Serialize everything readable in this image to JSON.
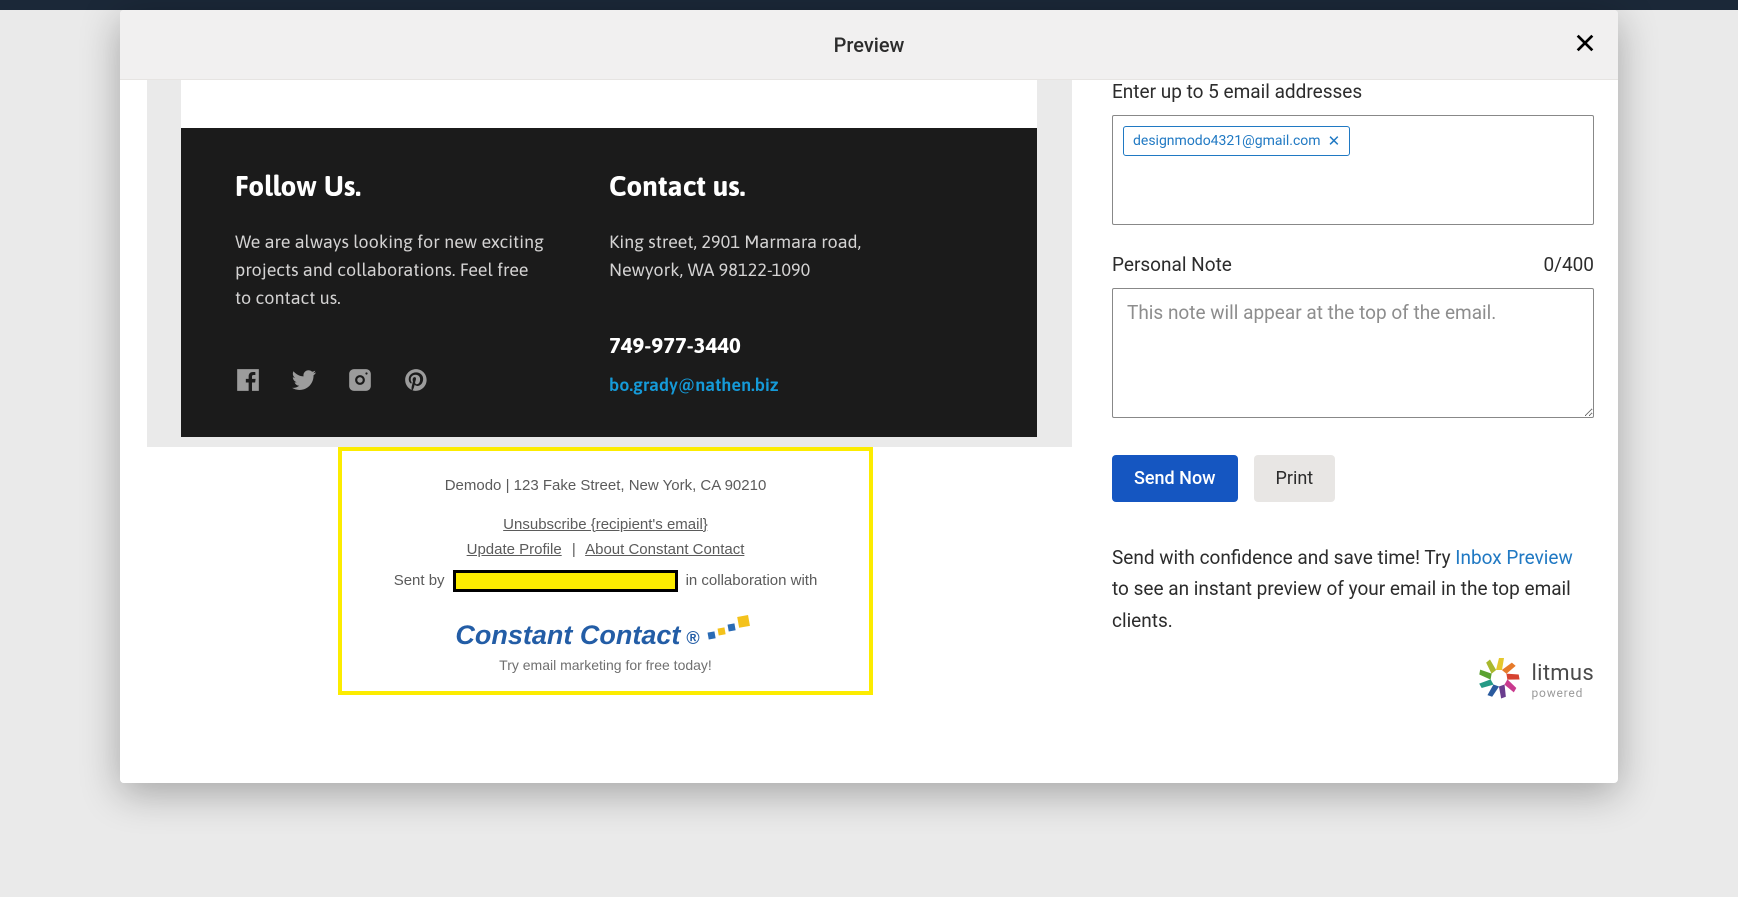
{
  "modal": {
    "title": "Preview"
  },
  "email_footer": {
    "follow": {
      "heading": "Follow Us.",
      "text": "We are always looking for new exciting projects and collaborations. Feel free to contact us."
    },
    "contact": {
      "heading": "Contact us.",
      "address": "King street, 2901 Marmara road, Newyork, WA 98122-1090",
      "phone": "749-977-3440",
      "email": "bo.grady@nathen.biz"
    }
  },
  "cc_footer": {
    "address": "Demodo | 123 Fake Street, New York, CA 90210",
    "unsubscribe": "Unsubscribe {recipient's email}",
    "update_profile": "Update Profile",
    "about": "About Constant Contact",
    "sent_by_prefix": "Sent by",
    "collab": "in collaboration with",
    "logo_text": "Constant Contact",
    "try_text": "Try email marketing for free today!"
  },
  "form": {
    "email_label": "Enter up to 5 email addresses",
    "chips": [
      "designmodo4321@gmail.com"
    ],
    "note_label": "Personal Note",
    "note_count": "0/400",
    "note_placeholder": "This note will appear at the top of the email.",
    "send_btn": "Send Now",
    "print_btn": "Print"
  },
  "promo": {
    "text_1": "Send with confidence and save time! Try ",
    "link": "Inbox Preview",
    "text_2": " to see an instant preview of your email in the top email clients."
  },
  "litmus": {
    "name": "litmus",
    "sub": "powered"
  }
}
